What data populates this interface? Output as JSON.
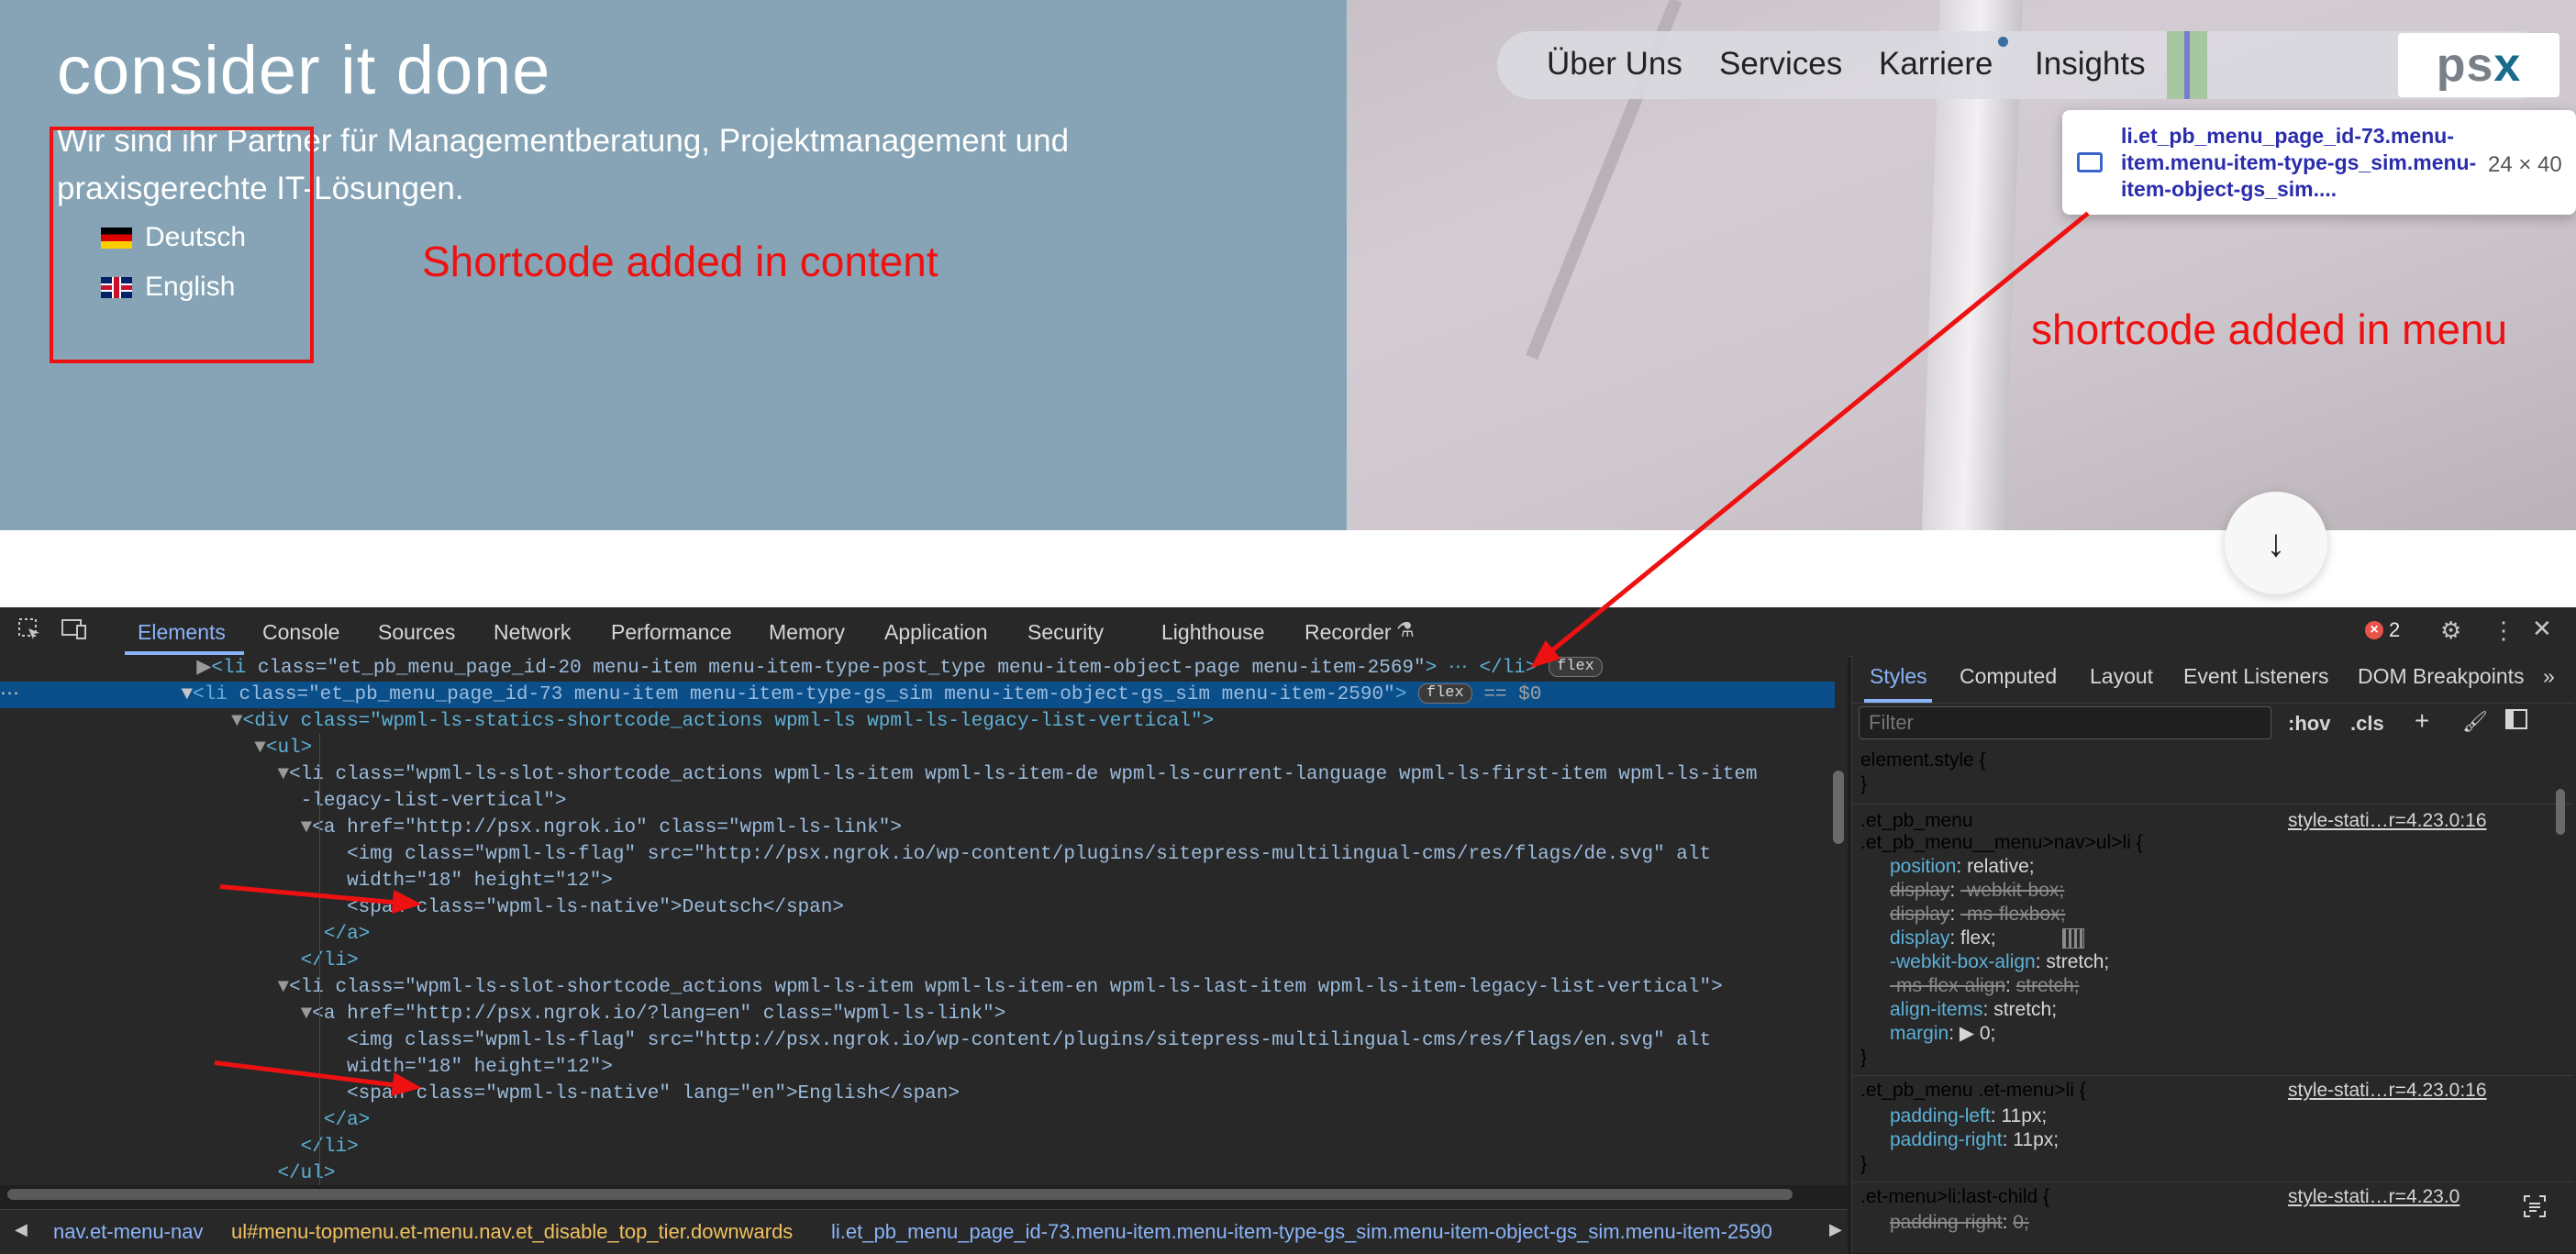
{
  "site": {
    "tagline": "consider it done",
    "subline": "Wir sind ihr Partner für Managementberatung, Projektmanagement und praxisgerechte IT-Lösungen.",
    "lang_de": "Deutsch",
    "lang_en": "English",
    "annotation_content": "Shortcode added in content",
    "annotation_menu": "shortcode added in menu",
    "menu": [
      "Über Uns",
      "Services",
      "Karriere",
      "Insights"
    ],
    "logo_a": "ps",
    "logo_b": "x",
    "tooltip_text": "li.et_pb_menu_page_id-73.menu-item.menu-item-type-gs_sim.menu-item-object-gs_sim....",
    "tooltip_size": "24 × 40",
    "scroll_arrow": "↓"
  },
  "devtools": {
    "tabs": [
      "Elements",
      "Console",
      "Sources",
      "Network",
      "Performance",
      "Memory",
      "Application",
      "Security",
      "Lighthouse",
      "Recorder"
    ],
    "active_tab": "Elements",
    "error_count": "2",
    "styles_tabs": [
      "Styles",
      "Computed",
      "Layout",
      "Event Listeners",
      "DOM Breakpoints"
    ],
    "filter_placeholder": "Filter",
    "hov": ":hov",
    "cls": ".cls",
    "breadcrumb": [
      "nav.et-menu-nav",
      "ul#menu-topmenu.et-menu.nav.et_disable_top_tier.downwards",
      "li.et_pb_menu_page_id-73.menu-item.menu-item-type-gs_sim.menu-item-object-gs_sim.menu-item-2590"
    ]
  },
  "dom_lines": [
    {
      "tag": "<li ",
      "attrs": "class=\"et_pb_menu_page_id-20 menu-item menu-item-type-post_type menu-item-object-page menu-item-2569\"",
      "tail": "> ⋯ </li>",
      "pill": "flex"
    },
    {
      "tag": "<li ",
      "attrs": "class=\"et_pb_menu_page_id-73 menu-item menu-item-type-gs_sim menu-item-object-gs_sim menu-item-2590\"",
      "tail": ">",
      "pill": "flex",
      "eq": "== $0"
    },
    {
      "text": "<div class=\"wpml-ls-statics-shortcode_actions wpml-ls wpml-ls-legacy-list-vertical\">"
    },
    {
      "text": "<ul>"
    },
    {
      "text": "<li class=\"wpml-ls-slot-shortcode_actions wpml-ls-item wpml-ls-item-de wpml-ls-current-language wpml-ls-first-item wpml-ls-item"
    },
    {
      "text": "-legacy-list-vertical\">"
    },
    {
      "text": "<a href=\"http://psx.ngrok.io\" class=\"wpml-ls-link\">"
    },
    {
      "text": "<img class=\"wpml-ls-flag\" src=\"http://psx.ngrok.io/wp-content/plugins/sitepress-multilingual-cms/res/flags/de.svg\" alt"
    },
    {
      "text": "width=\"18\" height=\"12\">"
    },
    {
      "text": "<span class=\"wpml-ls-native\">Deutsch</span>"
    },
    {
      "text": "</a>"
    },
    {
      "text": "</li>"
    },
    {
      "text": "<li class=\"wpml-ls-slot-shortcode_actions wpml-ls-item wpml-ls-item-en wpml-ls-last-item wpml-ls-item-legacy-list-vertical\">"
    },
    {
      "text": "<a href=\"http://psx.ngrok.io/?lang=en\" class=\"wpml-ls-link\">"
    },
    {
      "text": "<img class=\"wpml-ls-flag\" src=\"http://psx.ngrok.io/wp-content/plugins/sitepress-multilingual-cms/res/flags/en.svg\" alt"
    },
    {
      "text": "width=\"18\" height=\"12\">"
    },
    {
      "text": "<span class=\"wpml-ls-native\" lang=\"en\">English</span>"
    },
    {
      "text": "</a>"
    },
    {
      "text": "</li>"
    },
    {
      "text": "</ul>"
    }
  ],
  "styles": {
    "element_style": "element.style {",
    "close": "}",
    "rule1_sel1": ".et_pb_menu",
    "rule1_sel2": ".et_pb_menu__menu>nav>ul>li {",
    "rule1_src": "style-stati…r=4.23.0:16",
    "rule1_props": [
      {
        "p": "position",
        "v": "relative;",
        "s": false
      },
      {
        "p": "display",
        "v": "-webkit-box;",
        "s": true
      },
      {
        "p": "display",
        "v": "-ms-flexbox;",
        "s": true
      },
      {
        "p": "display",
        "v": "flex;",
        "s": false
      },
      {
        "p": "-webkit-box-align",
        "v": "stretch;",
        "s": false
      },
      {
        "p": "-ms-flex-align",
        "v": "stretch;",
        "s": true
      },
      {
        "p": "align-items",
        "v": "stretch;",
        "s": false
      },
      {
        "p": "margin",
        "v": "▶ 0;",
        "s": false
      }
    ],
    "rule2_sel": ".et_pb_menu .et-menu>li {",
    "rule2_src": "style-stati…r=4.23.0:16",
    "rule2_props": [
      {
        "p": "padding-left",
        "v": "11px;",
        "s": false
      },
      {
        "p": "padding-right",
        "v": "11px;",
        "s": false
      }
    ],
    "rule3_sel": ".et-menu>li:last-child {",
    "rule3_src": "style-stati…r=4.23.0",
    "rule3_props": [
      {
        "p": "padding-right",
        "v": "0;",
        "s": true
      }
    ]
  }
}
